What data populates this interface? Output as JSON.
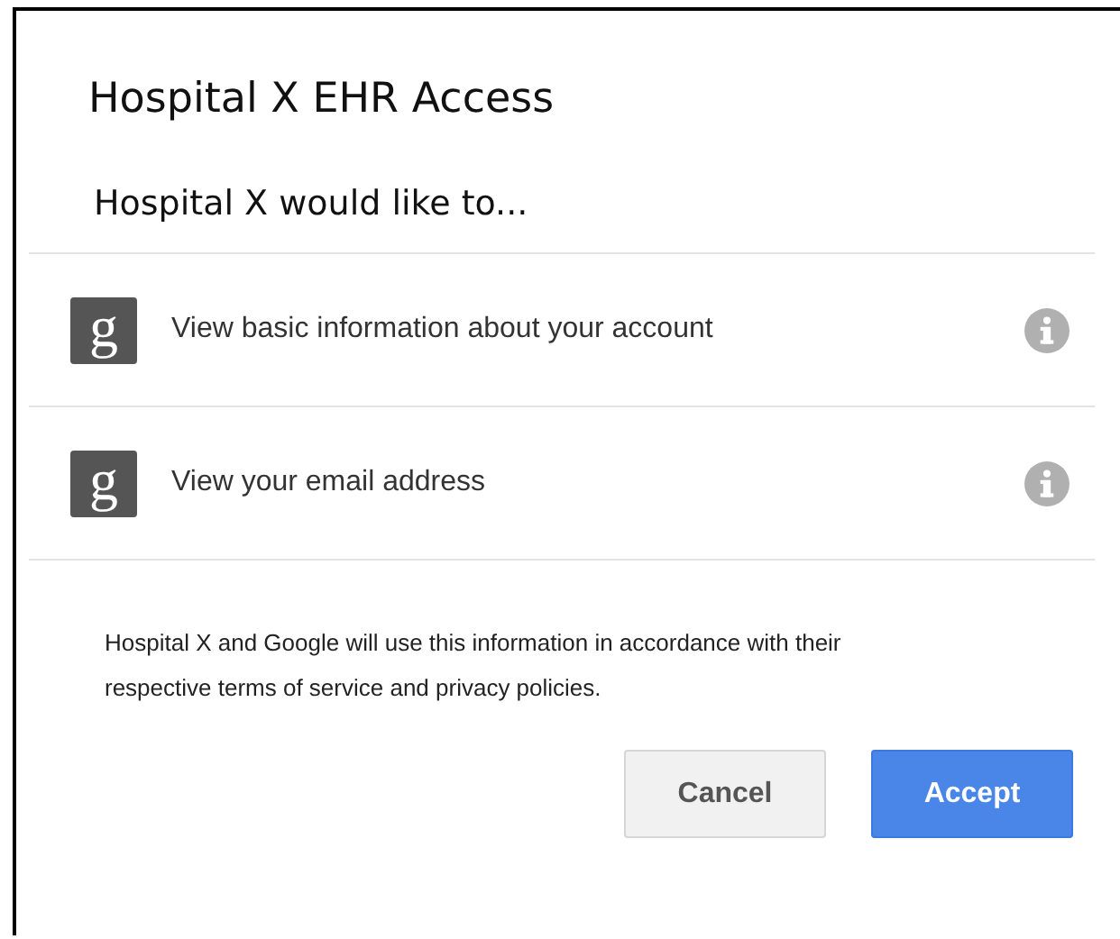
{
  "dialog": {
    "title": "Hospital X EHR Access",
    "subtitle": "Hospital X would like to...",
    "permissions": [
      {
        "icon": "g",
        "label": "View basic information about your account"
      },
      {
        "icon": "g",
        "label": "View your email address"
      }
    ],
    "notice": "Hospital X and Google will use this information in accordance with their respective terms of service and privacy policies.",
    "buttons": [
      {
        "label": "Cancel",
        "kind": "secondary"
      },
      {
        "label": "Accept",
        "kind": "primary"
      }
    ]
  }
}
